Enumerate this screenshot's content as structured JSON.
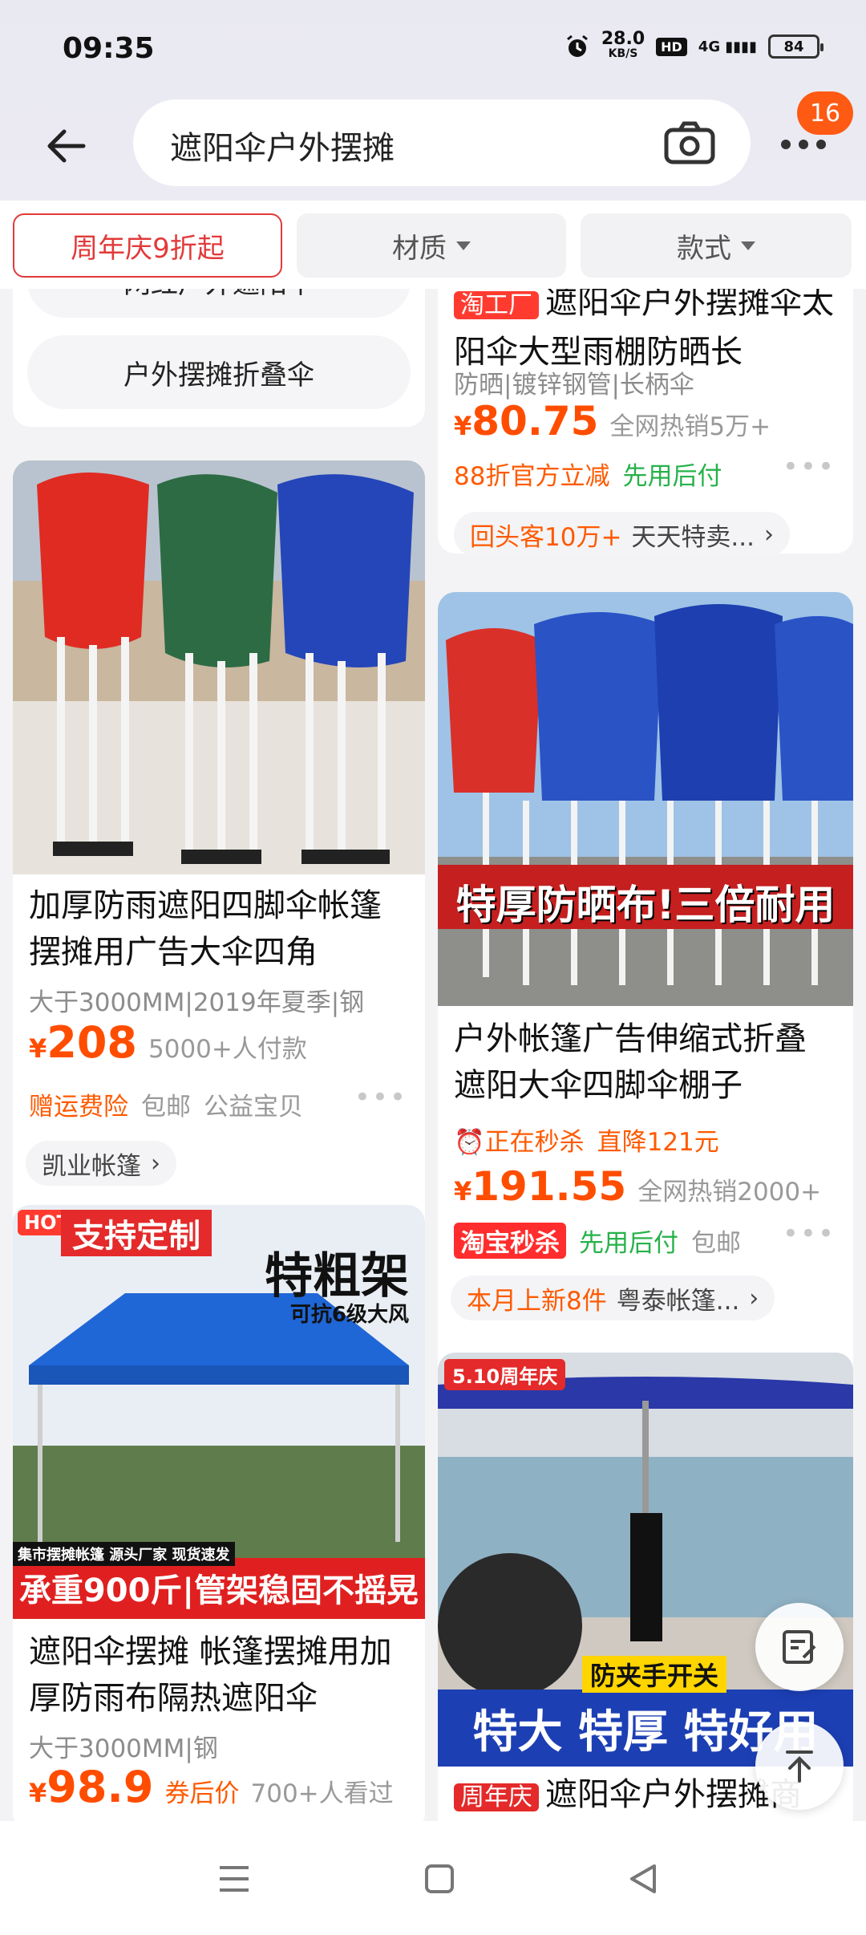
{
  "status": {
    "time": "09:35",
    "net_speed": "28.0",
    "net_unit": "KB/S",
    "hd": "HD",
    "signal": "4G",
    "battery": "84"
  },
  "search": {
    "query": "遮阳伞户外摆摊",
    "badge_count": "16"
  },
  "filters": [
    {
      "label": "周年庆9折起",
      "active": true
    },
    {
      "label": "材质",
      "active": false
    },
    {
      "label": "款式",
      "active": false
    }
  ],
  "suggestions": {
    "items": [
      "网红户外遮阳伞",
      "户外摆摊折叠伞"
    ]
  },
  "products": {
    "p1": {
      "title_tag": "淘工厂",
      "title": "遮阳伞户外摆摊伞太阳伞大型雨棚防晒长",
      "attrs": "防晒|镀锌钢管|长柄伞",
      "price_symbol": "¥",
      "price": "80.75",
      "sales": "全网热销5万+",
      "promo1": "88折官方立减",
      "promo2": "先用后付",
      "shop_tag": "回头客10万+",
      "shop": "天天特卖..."
    },
    "p2": {
      "title": "加厚防雨遮阳四脚伞帐篷摆摊用广告大伞四角",
      "attrs": "大于3000MM|2019年夏季|钢",
      "price_symbol": "¥",
      "price": "208",
      "sales": "5000+人付款",
      "promo1": "赠运费险",
      "promo2": "包邮",
      "promo3": "公益宝贝",
      "shop": "凯业帐篷"
    },
    "p3": {
      "banner": "特厚防晒布!三倍耐用",
      "title": "户外帐篷广告伸缩式折叠遮阳大伞四脚伞棚子",
      "flash": "正在秒杀",
      "drop": "直降121元",
      "price_symbol": "¥",
      "price": "191.55",
      "sales": "全网热销2000+",
      "tag": "淘宝秒杀",
      "promo2": "先用后付",
      "promo3": "包邮",
      "shop_tag": "本月上新8件",
      "shop": "粤泰帐篷..."
    },
    "p4": {
      "corner": "HOT",
      "badge": "支持定制",
      "headline": "特粗架",
      "sub": "可抗6级大风",
      "strip": "集市摆摊帐篷 源头厂家 现货速发",
      "banner": "承重900斤|管架稳固不摇晃",
      "title": "遮阳伞摆摊 帐篷摆摊用加厚防雨布隔热遮阳伞",
      "attrs": "大于3000MM|钢",
      "price_symbol": "¥",
      "price": "98.9",
      "coupon": "券后价",
      "sales": "700+人看过"
    },
    "p5": {
      "corner": "5.10周年庆",
      "sub": "防夹手开关",
      "banner": "特大 特厚 特好用",
      "tag": "周年庆",
      "title": "遮阳伞户外摆摊商"
    }
  },
  "colors": {
    "accent": "#ff4d00",
    "brand_red": "#e23a3a",
    "green": "#27b24a"
  }
}
